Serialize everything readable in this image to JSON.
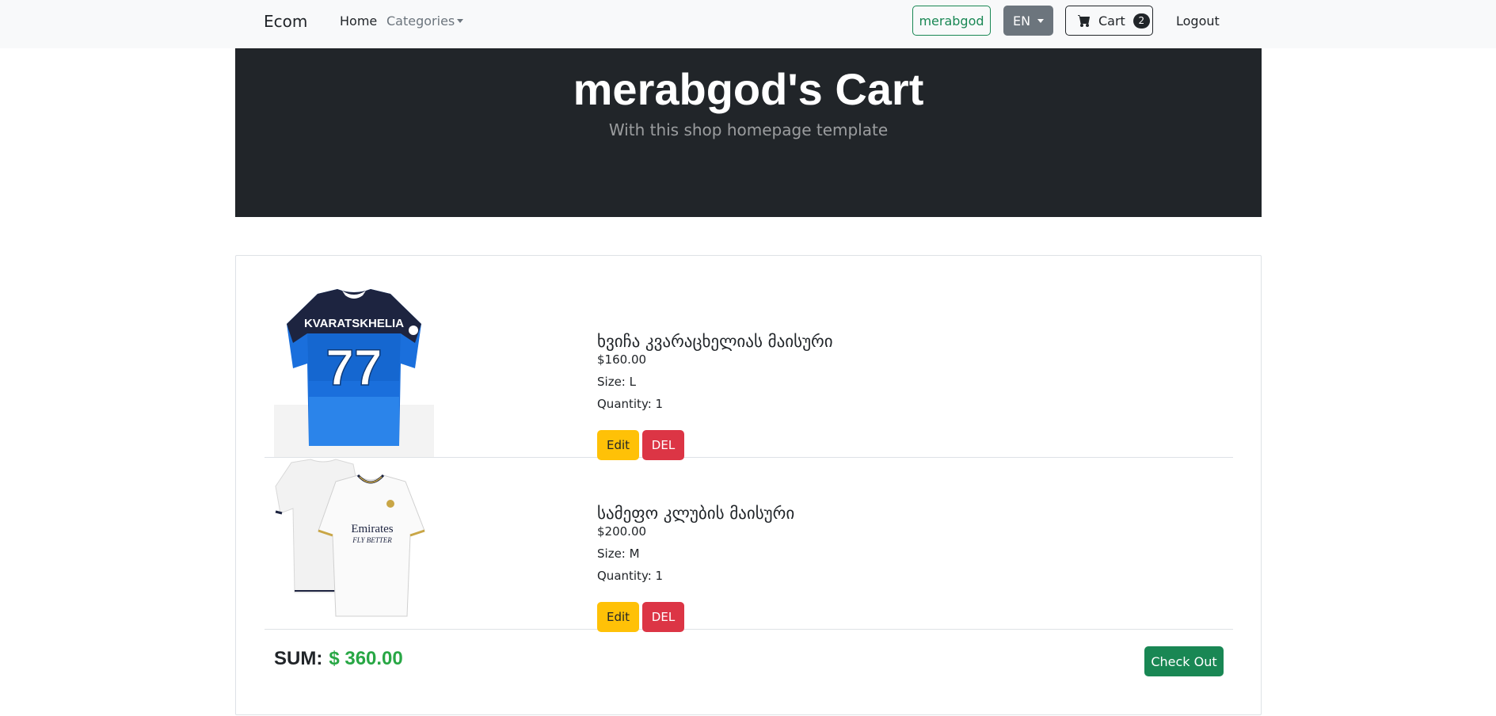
{
  "navbar": {
    "brand": "Ecom",
    "home": "Home",
    "categories": "Categories",
    "user_button": "merabgod",
    "language": "EN",
    "cart_label": "Cart",
    "cart_count": "2",
    "logout": "Logout"
  },
  "header": {
    "title": "merabgod's Cart",
    "subtitle": "With this shop homepage template"
  },
  "cart": {
    "items": [
      {
        "name": "ხვიჩა კვარაცხელიას მაისური",
        "price": "$160.00",
        "size": "Size: L",
        "quantity": "Quantity: 1",
        "edit_label": "Edit",
        "delete_label": "DEL",
        "image": "blue-jersey-kvaratskhelia-77"
      },
      {
        "name": "სამეფო კლუბის მაისური",
        "price": "$200.00",
        "size": "Size: M",
        "quantity": "Quantity: 1",
        "edit_label": "Edit",
        "delete_label": "DEL",
        "image": "white-jersey-emirates"
      }
    ],
    "sum_label": "SUM:",
    "sum_value": "$ 360.00",
    "checkout_label": "Check Out"
  },
  "jersey_text": {
    "player_name": "KVARATSKHELIA",
    "number": "77",
    "sponsor": "Emirates",
    "sponsor_tagline": "FLY BETTER"
  },
  "colors": {
    "success": "#198754",
    "warning": "#ffc107",
    "danger": "#dc3545",
    "dark": "#212529",
    "secondary": "#6c757d",
    "sum_green": "#28a745"
  }
}
